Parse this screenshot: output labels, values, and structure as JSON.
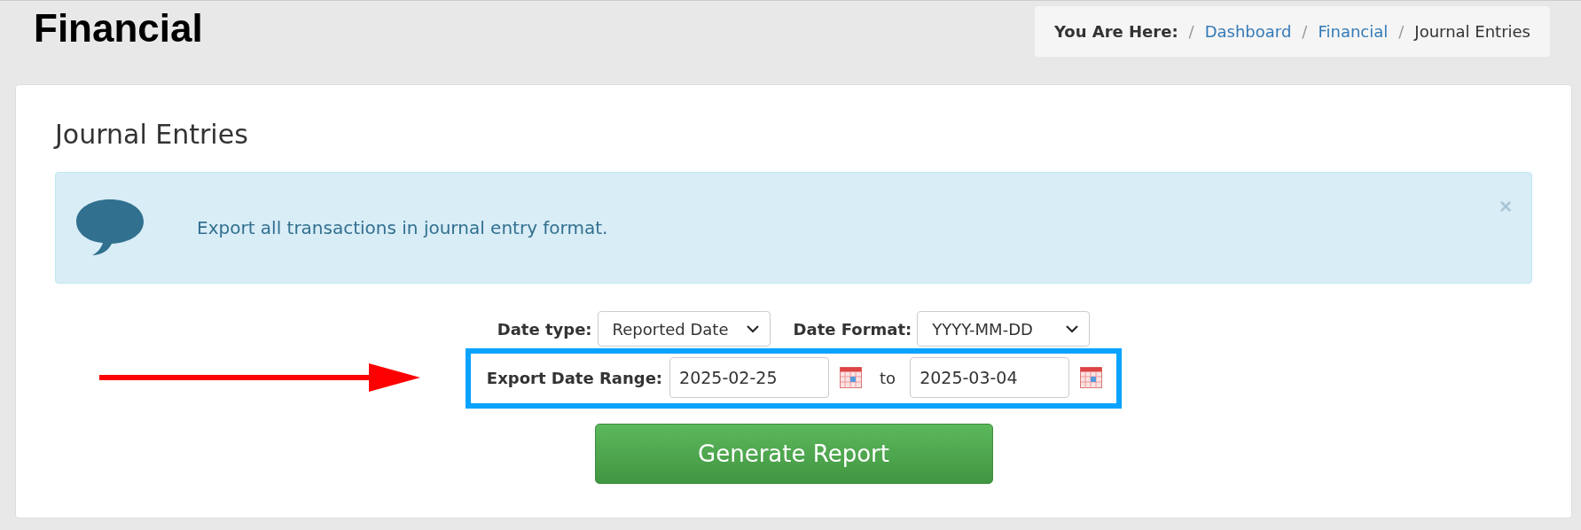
{
  "page_title": "Financial",
  "breadcrumb": {
    "label": "You Are Here:",
    "items": [
      {
        "separator": "/",
        "text": "Dashboard",
        "kind": "link"
      },
      {
        "separator": "/",
        "text": "Financial",
        "kind": "link"
      },
      {
        "separator": "/",
        "text": "Journal Entries",
        "kind": "current"
      }
    ]
  },
  "panel": {
    "title": "Journal Entries",
    "alert": {
      "message": "Export all transactions in journal entry format.",
      "close": "×"
    },
    "date_type": {
      "label": "Date type:",
      "value": "Reported Date"
    },
    "date_format": {
      "label": "Date Format:",
      "value": "YYYY-MM-DD"
    },
    "date_range": {
      "label": "Export Date Range:",
      "from": "2025-02-25",
      "separator": "to",
      "to": "2025-03-04"
    },
    "button": "Generate Report"
  }
}
